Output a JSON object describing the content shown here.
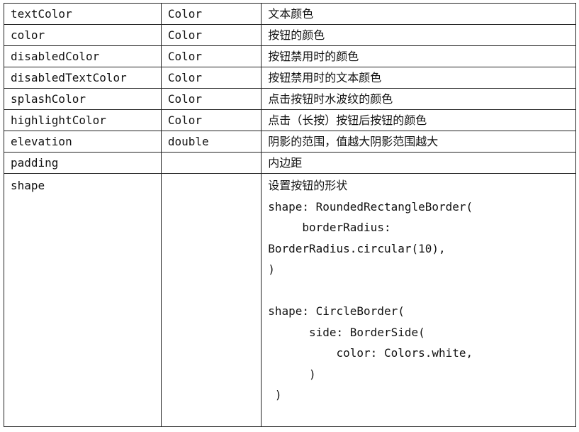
{
  "rows": [
    {
      "name": "textColor",
      "type": "Color",
      "desc": "文本颜色"
    },
    {
      "name": "color",
      "type": "Color",
      "desc": "按钮的颜色"
    },
    {
      "name": "disabledColor",
      "type": "Color",
      "desc": "按钮禁用时的颜色"
    },
    {
      "name": "disabledTextColor",
      "type": "Color",
      "desc": "按钮禁用时的文本颜色"
    },
    {
      "name": "splashColor",
      "type": "Color",
      "desc": "点击按钮时水波纹的颜色"
    },
    {
      "name": "highlightColor",
      "type": "Color",
      "desc": "点击（长按）按钮后按钮的颜色"
    },
    {
      "name": "elevation",
      "type": "double",
      "desc": "阴影的范围，值越大阴影范围越大"
    },
    {
      "name": "padding",
      "type": "",
      "desc": "内边距"
    }
  ],
  "shape_row": {
    "name": "shape",
    "type": "",
    "lines": [
      "设置按钮的形状",
      "shape: RoundedRectangleBorder(",
      "     borderRadius:",
      "BorderRadius.circular(10),",
      ")",
      "",
      "shape: CircleBorder(",
      "      side: BorderSide(",
      "          color: Colors.white,",
      "      )",
      " )"
    ]
  }
}
